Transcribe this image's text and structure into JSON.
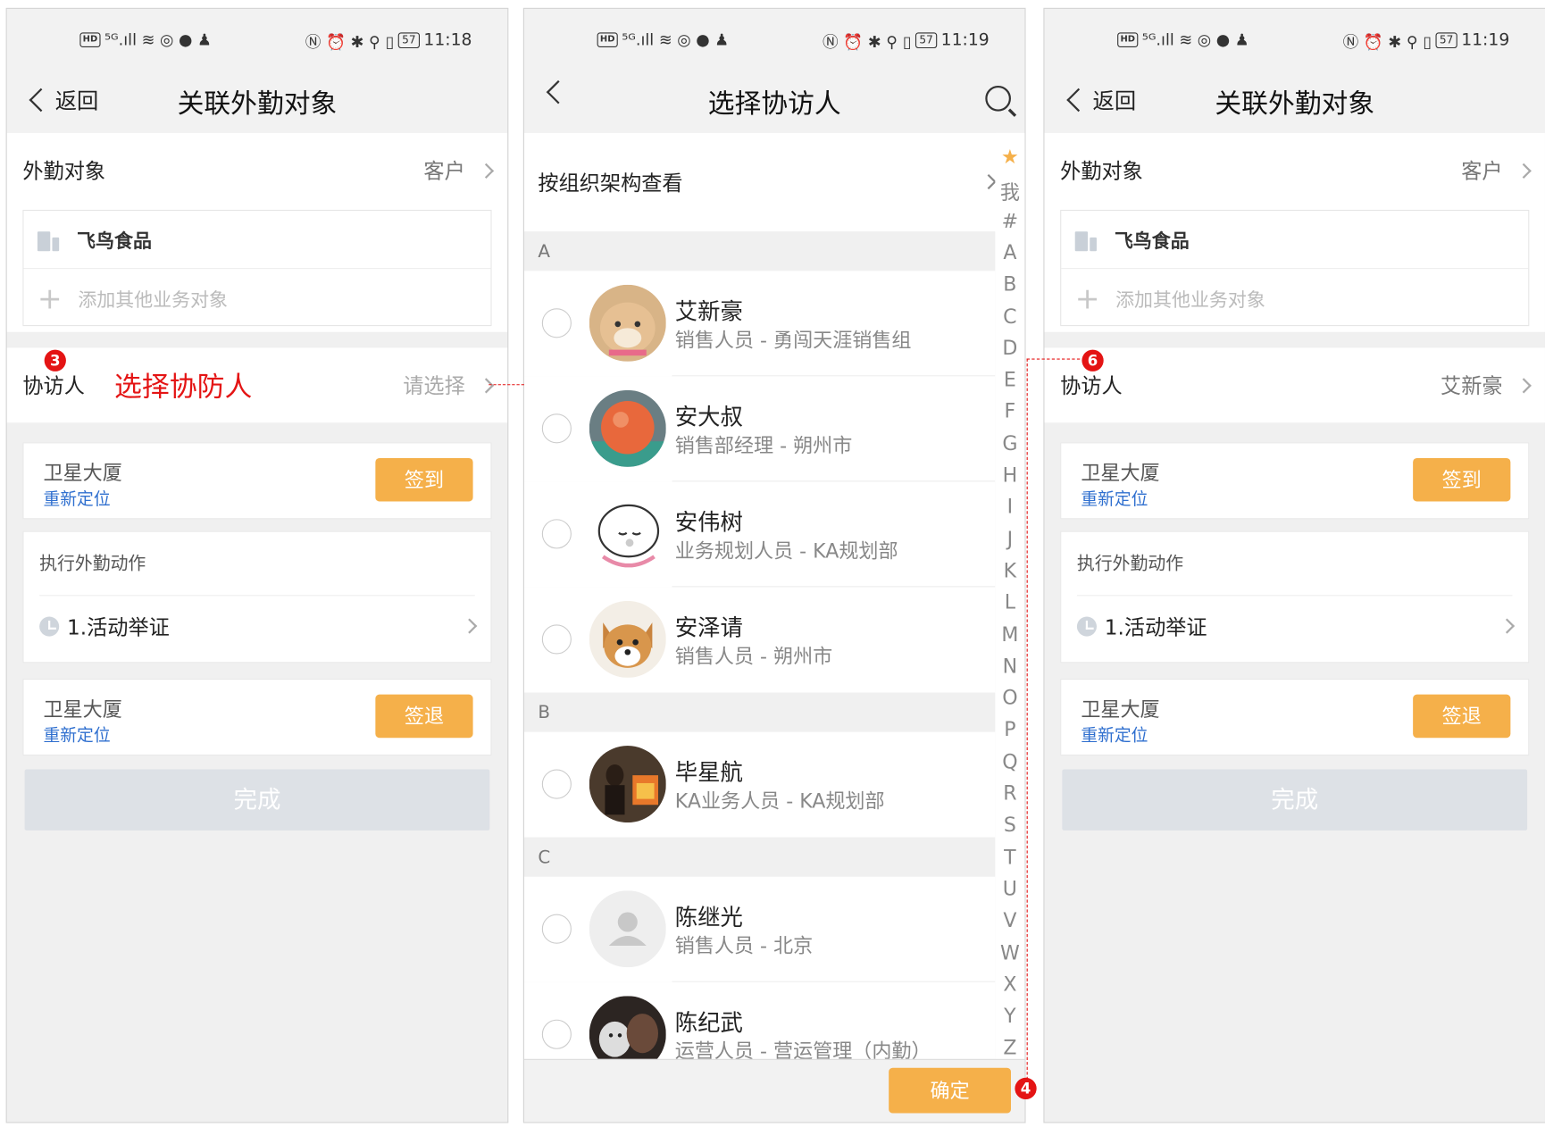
{
  "status_bar": {
    "left_icons": "HD ⁵ᴳ.ıll ≋ ◎ ● ♟",
    "right_icons": "Ⓝ ⏰ ✱ ⚲ ▯",
    "battery": "57",
    "time_p1": "11:18",
    "time_p2": "11:19",
    "time_p3": "11:19"
  },
  "panel1": {
    "back_label": "返回",
    "title": "关联外勤对象",
    "target_label": "外勤对象",
    "target_value": "客户",
    "company": "飞鸟食品",
    "add_other": "添加其他业务对象",
    "visitor_label": "协访人",
    "visitor_annotation": "选择协防人",
    "visitor_value": "请选择",
    "step_badge": "3",
    "checkin": {
      "location": "卫星大厦",
      "relocate": "重新定位",
      "button": "签到"
    },
    "actions": {
      "header": "执行外勤动作",
      "item": "1.活动举证"
    },
    "checkout": {
      "location": "卫星大厦",
      "relocate": "重新定位",
      "button": "签退"
    },
    "done": "完成"
  },
  "panel2": {
    "title": "选择协访人",
    "org_view": "按组织架构查看",
    "sections": [
      {
        "letter": "A",
        "contacts": [
          {
            "name": "艾新豪",
            "desc": "销售人员 - 勇闯天涯销售组",
            "avatar": "shiba-avatar"
          },
          {
            "name": "安大叔",
            "desc": "销售部经理 - 朔州市",
            "avatar": "fruit-avatar"
          },
          {
            "name": "安伟树",
            "desc": "业务规划人员 - KA规划部",
            "avatar": "cartoon-avatar"
          },
          {
            "name": "安泽请",
            "desc": "销售人员 - 朔州市",
            "avatar": "dog-avatar"
          }
        ]
      },
      {
        "letter": "B",
        "contacts": [
          {
            "name": "毕星航",
            "desc": "KA业务人员 - KA规划部",
            "avatar": "fireplace-avatar"
          }
        ]
      },
      {
        "letter": "C",
        "contacts": [
          {
            "name": "陈继光",
            "desc": "销售人员 - 北京",
            "avatar": "default-avatar"
          },
          {
            "name": "陈纪武",
            "desc": "运营人员 - 营运管理（内勤）",
            "avatar": "cat-avatar"
          }
        ]
      }
    ],
    "index": [
      "★",
      "我",
      "#",
      "A",
      "B",
      "C",
      "D",
      "E",
      "F",
      "G",
      "H",
      "I",
      "J",
      "K",
      "L",
      "M",
      "N",
      "O",
      "P",
      "Q",
      "R",
      "S",
      "T",
      "U",
      "V",
      "W",
      "X",
      "Y",
      "Z"
    ],
    "confirm": "确定",
    "step_badge": "4"
  },
  "panel3": {
    "back_label": "返回",
    "title": "关联外勤对象",
    "target_label": "外勤对象",
    "target_value": "客户",
    "company": "飞鸟食品",
    "add_other": "添加其他业务对象",
    "visitor_label": "协访人",
    "visitor_value": "艾新豪",
    "step_badge": "6",
    "checkin": {
      "location": "卫星大厦",
      "relocate": "重新定位",
      "button": "签到"
    },
    "actions": {
      "header": "执行外勤动作",
      "item": "1.活动举证"
    },
    "checkout": {
      "location": "卫星大厦",
      "relocate": "重新定位",
      "button": "签退"
    },
    "done": "完成"
  },
  "colors": {
    "accent_orange": "#f5b04a",
    "link_blue": "#2f6fcf",
    "annotation_red": "#e41414",
    "done_disabled": "#dde1e6"
  }
}
